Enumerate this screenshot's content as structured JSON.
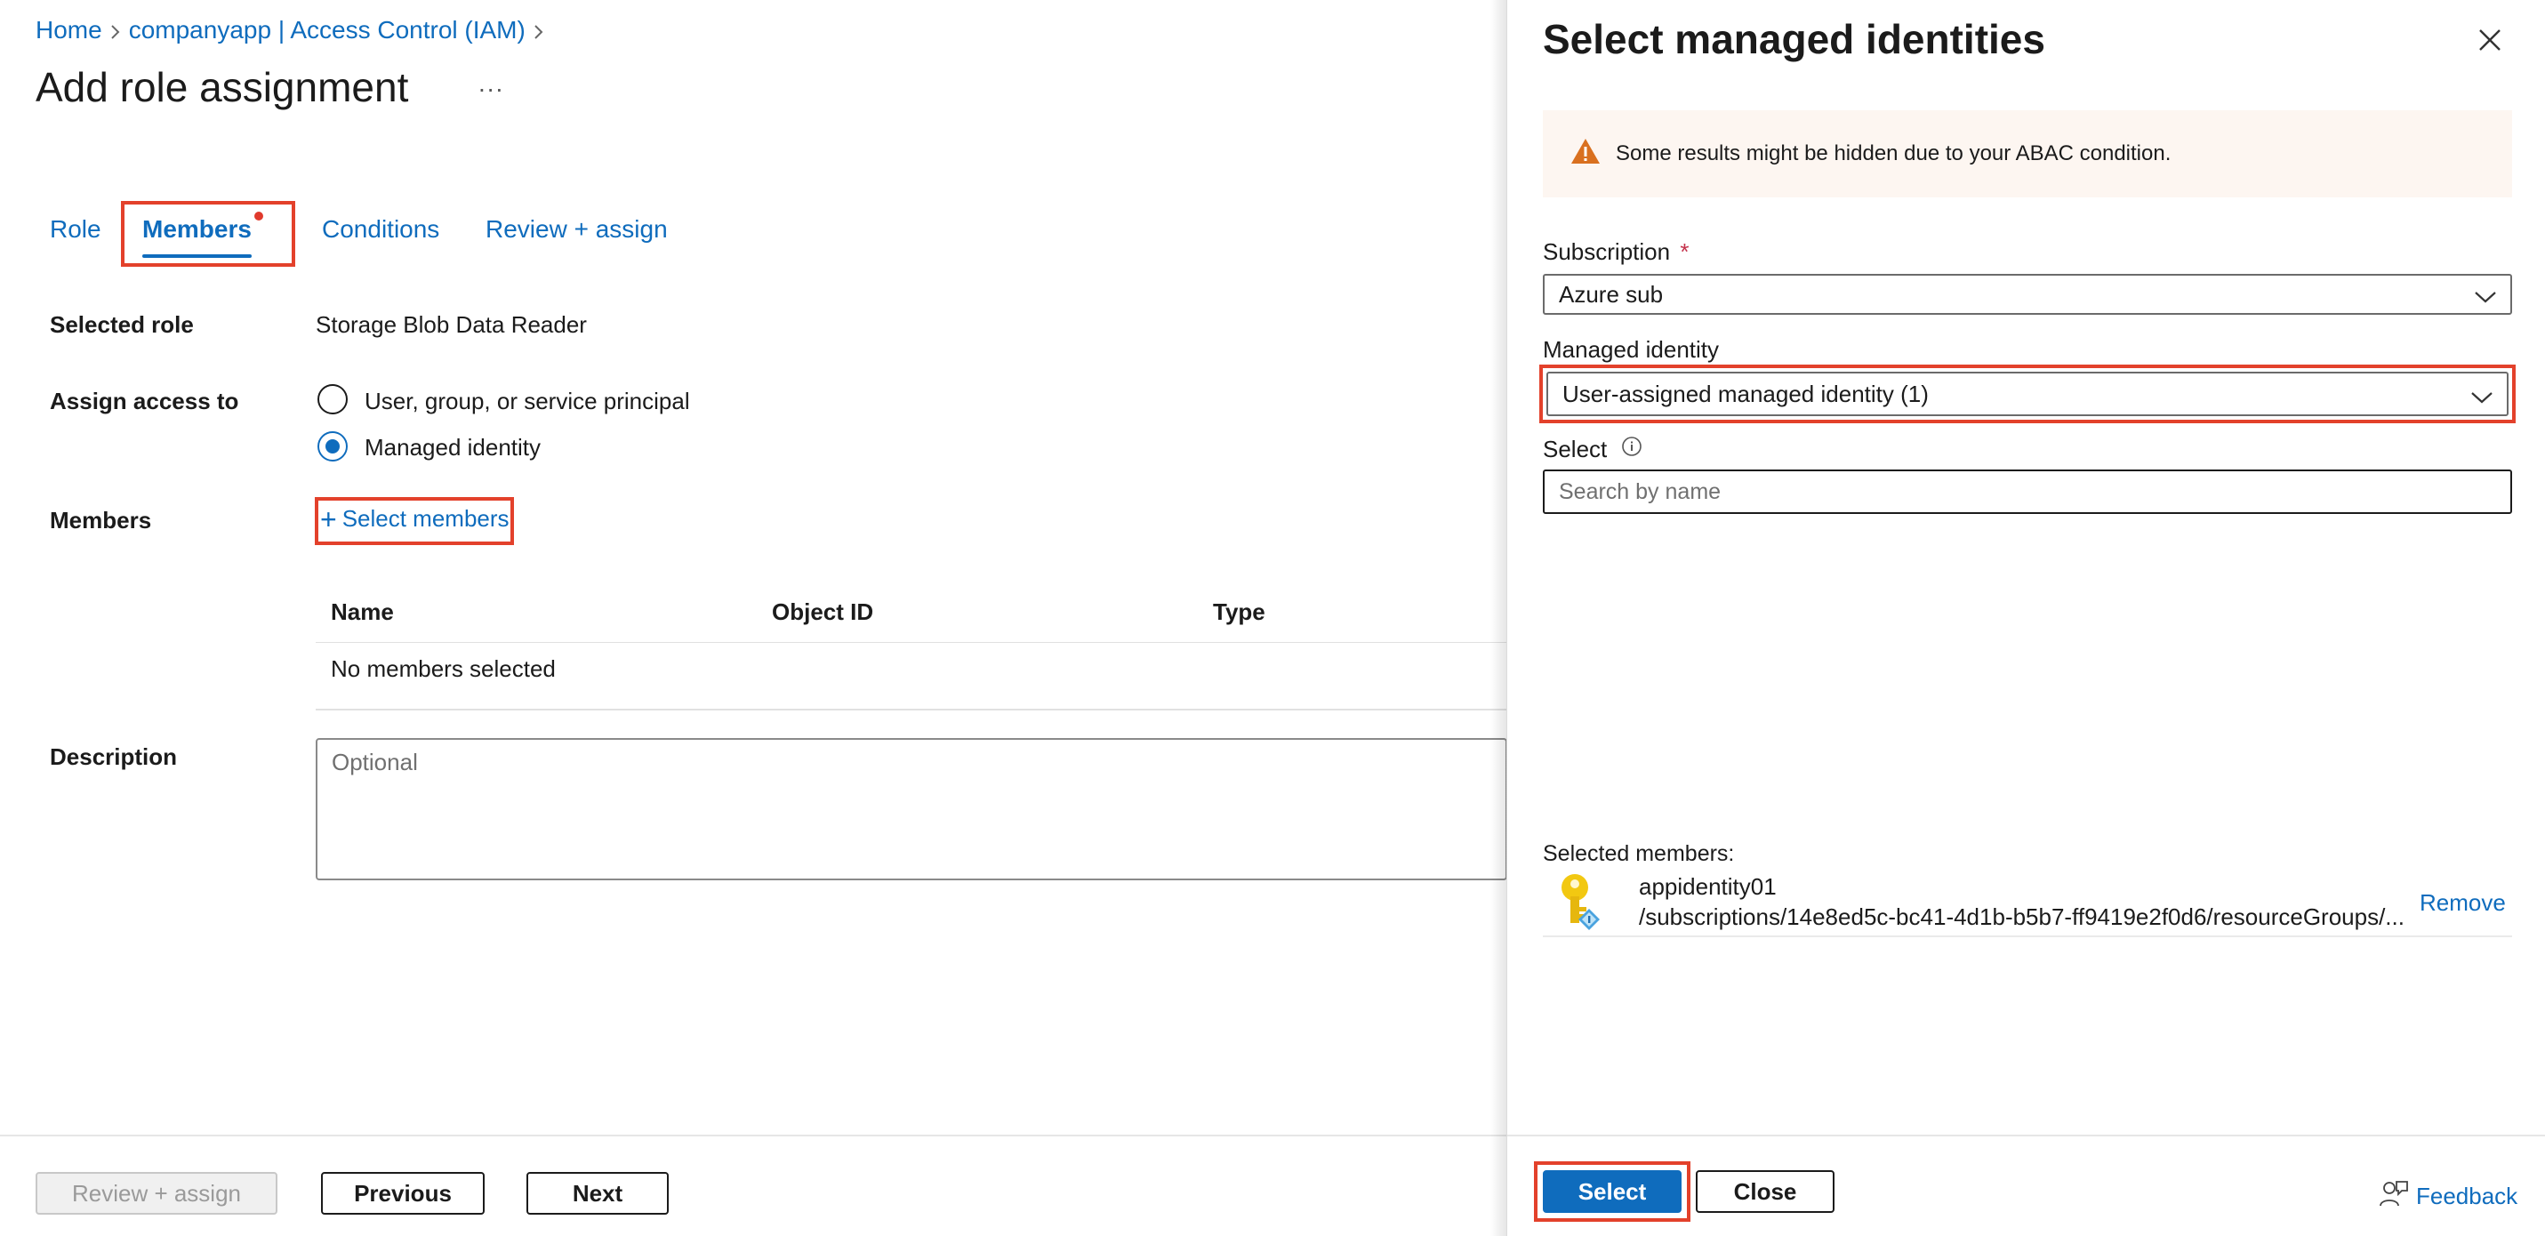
{
  "breadcrumb": {
    "home": "Home",
    "resource": "companyapp | Access Control (IAM)"
  },
  "page": {
    "title": "Add role assignment",
    "more": "..."
  },
  "tabs": [
    {
      "label": "Role",
      "active": false
    },
    {
      "label": "Members",
      "active": true
    },
    {
      "label": "Conditions",
      "active": false
    },
    {
      "label": "Review + assign",
      "active": false
    }
  ],
  "form": {
    "selected_role_label": "Selected role",
    "selected_role_value": "Storage Blob Data Reader",
    "assign_access_label": "Assign access to",
    "assign_options": [
      {
        "label": "User, group, or service principal",
        "checked": false
      },
      {
        "label": "Managed identity",
        "checked": true
      }
    ],
    "members_label": "Members",
    "select_members_link": "Select members",
    "table": {
      "columns": [
        "Name",
        "Object ID",
        "Type"
      ],
      "empty_text": "No members selected"
    },
    "description_label": "Description",
    "description_placeholder": "Optional"
  },
  "footer": {
    "review_assign": "Review + assign",
    "previous": "Previous",
    "next": "Next"
  },
  "panel": {
    "title": "Select managed identities",
    "warning_text": "Some results might be hidden due to your ABAC condition.",
    "subscription_label": "Subscription",
    "required_marker": "*",
    "subscription_value": "Azure sub",
    "managed_identity_label": "Managed identity",
    "managed_identity_value": "User-assigned managed identity (1)",
    "select_label": "Select",
    "search_placeholder": "Search by name",
    "selected_members_label": "Selected members:",
    "selected_members": [
      {
        "name": "appidentity01",
        "path": "/subscriptions/14e8ed5c-bc41-4d1b-b5b7-ff9419e2f0d6/resourceGroups/...",
        "remove": "Remove"
      }
    ],
    "select_button": "Select",
    "close_button": "Close",
    "feedback": "Feedback"
  },
  "colors": {
    "accent": "#0f6cbd",
    "highlight": "#e3412b",
    "warning_icon": "#d9701f",
    "warning_bg": "#fdf6f1"
  }
}
